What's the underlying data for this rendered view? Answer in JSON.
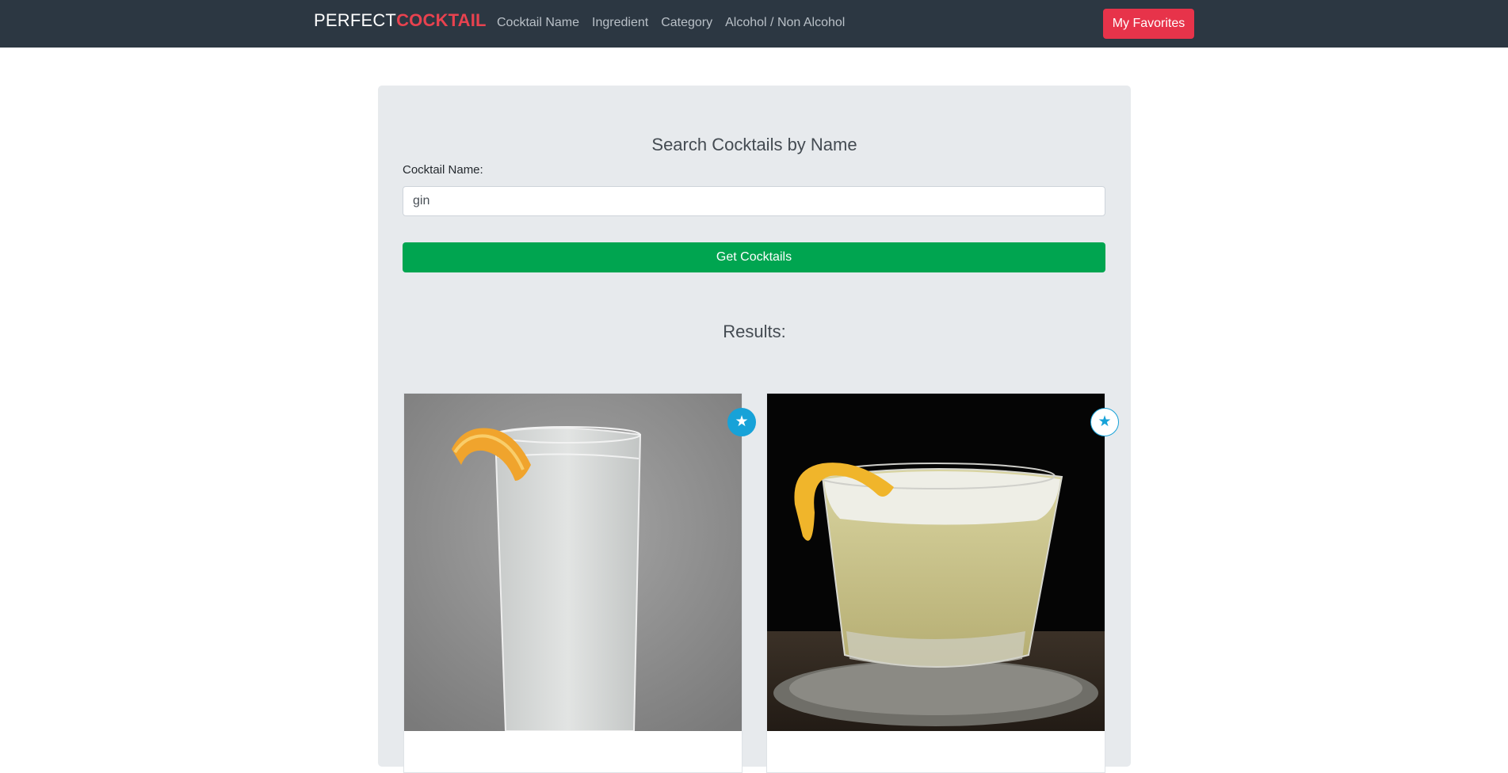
{
  "navbar": {
    "brand_part1": "PERFECT",
    "brand_part2": "COCKTAIL",
    "links": [
      "Cocktail Name",
      "Ingredient",
      "Category",
      "Alcohol / Non Alcohol"
    ],
    "favorites_label": "My Favorites"
  },
  "search": {
    "title": "Search Cocktails by Name",
    "field_label": "Cocktail Name:",
    "value": "gin",
    "button_label": "Get Cocktails"
  },
  "results": {
    "title": "Results:",
    "cards": [
      {
        "name": "",
        "image": "gin-fizz-highball-with-lemon-peel",
        "favorited": true
      },
      {
        "name": "",
        "image": "gin-sour-rocks-glass-with-lemon-peel",
        "favorited": false
      }
    ]
  },
  "colors": {
    "navbar_bg": "#2c3742",
    "brand_accent": "#e8424f",
    "favorites_btn": "#e7334a",
    "get_btn": "#00a550",
    "star": "#17a2d8"
  },
  "icons": {
    "favorite": "star-icon"
  }
}
